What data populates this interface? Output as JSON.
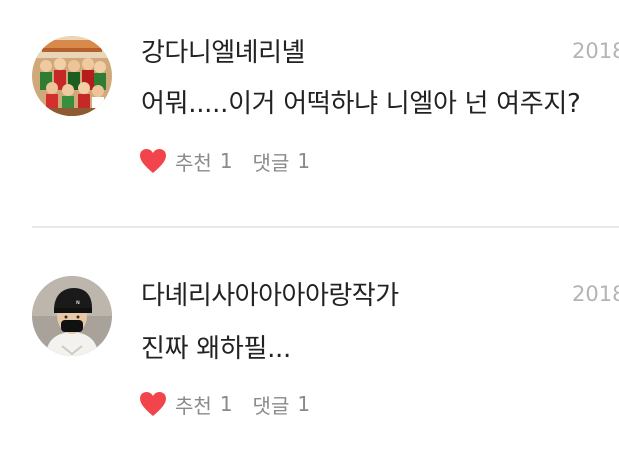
{
  "comments": [
    {
      "username": "강다니엘녜리녤",
      "date": "2018",
      "text": "어뭐.....이거 어떡하냐 니엘아 넌 여주지?",
      "like_label": "추천",
      "like_count": "1",
      "reply_label": "댓글",
      "reply_count": "1",
      "avatar_icon": "group-photo-avatar"
    },
    {
      "username": "다녜리사아아아아랑작가",
      "date": "2018",
      "text": "진짜 왜하필...",
      "like_label": "추천",
      "like_count": "1",
      "reply_label": "댓글",
      "reply_count": "1",
      "avatar_icon": "person-black-cap-mask-avatar"
    }
  ],
  "colors": {
    "heart": "#f2454b",
    "text": "#222222",
    "muted": "#8a8a8a",
    "date": "#b4b4b4",
    "divider": "#e8e8e8"
  }
}
